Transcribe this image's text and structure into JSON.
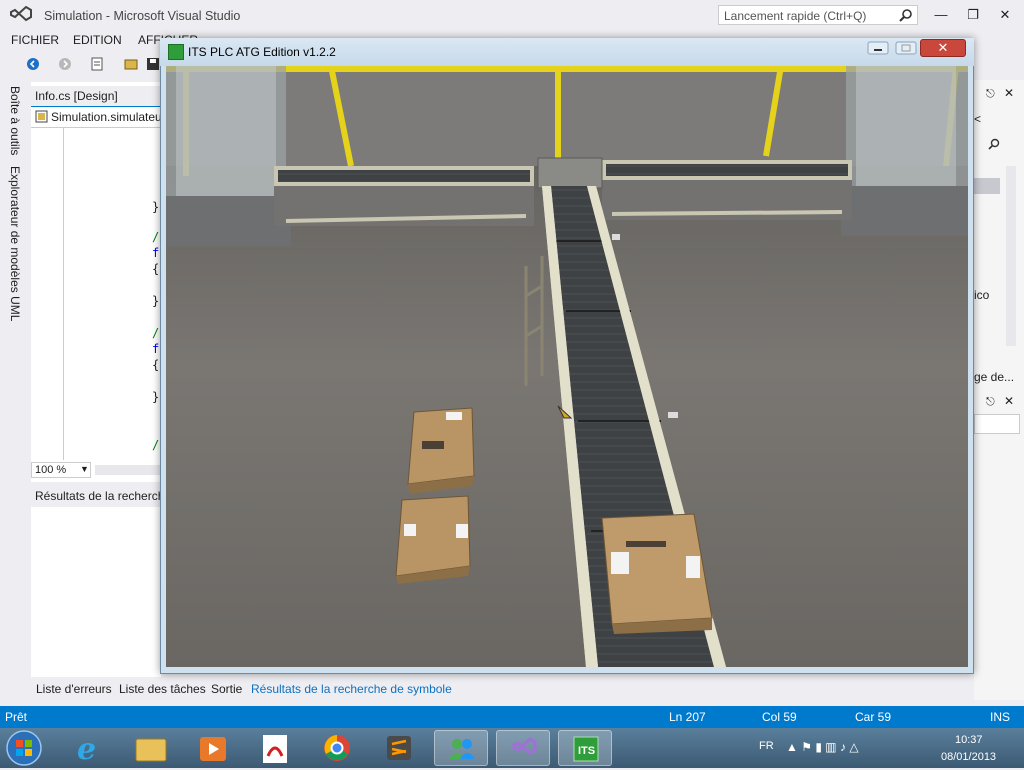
{
  "vs": {
    "title": "Simulation - Microsoft Visual Studio",
    "quick_launch_placeholder": "Lancement rapide (Ctrl+Q)",
    "menu": [
      "FICHIER",
      "EDITION",
      "AFFICHER"
    ],
    "left_tabs": [
      "Boîte à outils",
      "Explorateur de modèles UML"
    ],
    "doc_tab": "Info.cs [Design]",
    "nav_bar": "Simulation.simulateur",
    "zoom": "100 %",
    "results_title": "Résultats de la recherche",
    "bottom_tabs": [
      "Liste d'erreurs",
      "Liste des tâches",
      "Sortie",
      "Résultats de la recherche de symbole"
    ],
    "right_panel_text": [
      "ico",
      "ge de..."
    ],
    "status": {
      "ready": "Prêt",
      "ln": "Ln 207",
      "col": "Col 59",
      "car": "Car 59",
      "ins": "INS"
    }
  },
  "its": {
    "title": "ITS PLC ATG Edition v1.2.2"
  },
  "taskbar": {
    "language": "FR",
    "time": "10:37",
    "date": "08/01/2013"
  },
  "colors": {
    "accent": "#007acc",
    "close_red": "#c9473b",
    "its_green": "#2e9d3a"
  }
}
